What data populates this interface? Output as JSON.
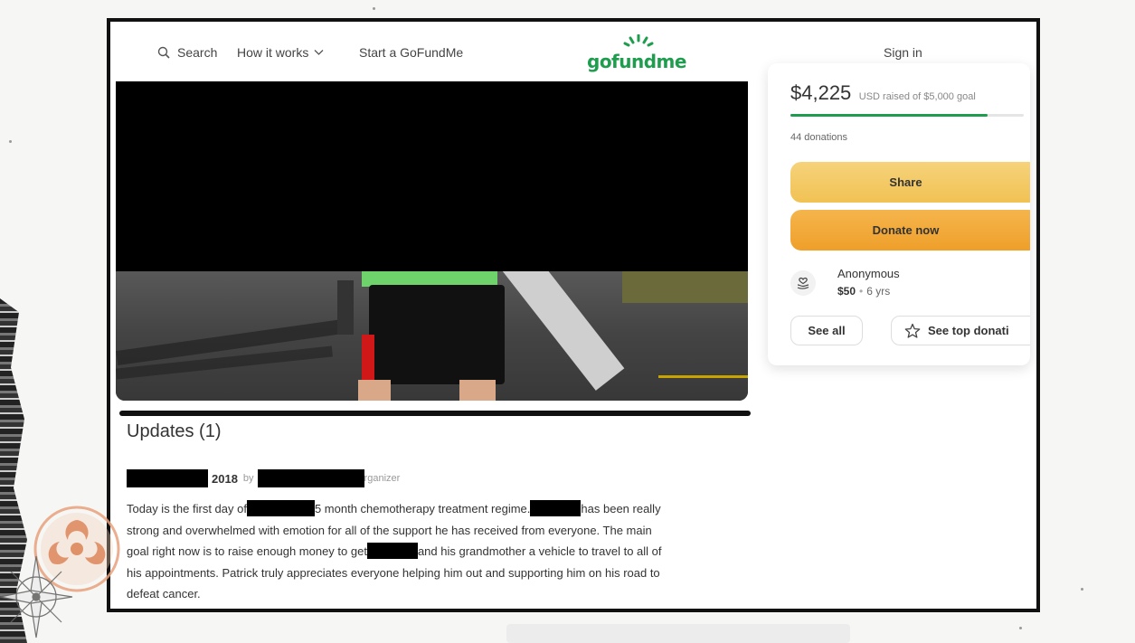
{
  "nav": {
    "search": "Search",
    "how_it_works": "How it works",
    "start": "Start a GoFundMe",
    "logo": "gofundme",
    "sign_in": "Sign in"
  },
  "updates": {
    "title": "Updates (1)",
    "year": "2018",
    "by": "by",
    "role": "rganizer",
    "text_1": "Today is the first day of",
    "text_2": "5 month chemotherapy treatment regime.",
    "text_3": "has been really strong and overwhelmed with emotion for all of the support he has received from everyone. The main goal right now is to raise enough money to get",
    "text_4": "and his grandmother a vehicle to travel to all of his appointments. Patrick truly appreciates everyone helping him out and supporting him on his road to defeat cancer."
  },
  "card": {
    "raised_amount": "$4,225",
    "raised_sub": "USD raised of $5,000 goal",
    "progress_fraction": 0.845,
    "donations": "44 donations",
    "share": "Share",
    "donate": "Donate now",
    "donor_name": "Anonymous",
    "donor_amount": "$50",
    "donor_sep": "•",
    "donor_time": "6 yrs",
    "see_all": "See all",
    "see_top": "See top donati"
  },
  "colors": {
    "brand_green": "#1f9d4e",
    "share_yellow": "#f1c254",
    "donate_orange": "#ef9f2a"
  },
  "icons": [
    "search-icon",
    "chevron-down-icon",
    "heart-hand-icon",
    "star-icon",
    "biohazard-icon",
    "compass-icon"
  ]
}
